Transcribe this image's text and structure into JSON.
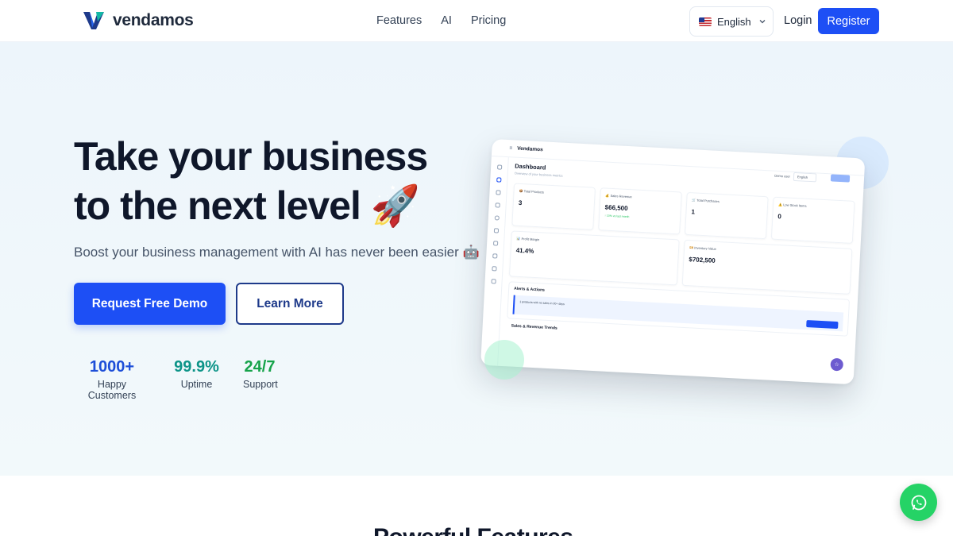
{
  "header": {
    "brand": "vendamos",
    "nav": [
      "Features",
      "AI",
      "Pricing"
    ],
    "language": "English",
    "login": "Login",
    "register": "Register"
  },
  "hero": {
    "title_line1": "Take your business",
    "title_line2": "to the next level 🚀",
    "subtitle": "Boost your business management with AI has never been easier 🤖",
    "cta_primary": "Request Free Demo",
    "cta_secondary": "Learn More",
    "stats": [
      {
        "value": "1000+",
        "label": "Happy Customers",
        "color": "#1d4ed8"
      },
      {
        "value": "99.9%",
        "label": "Uptime",
        "color": "#0d9488"
      },
      {
        "value": "24/7",
        "label": "Support",
        "color": "#16a34a"
      }
    ]
  },
  "mockup": {
    "app_name": "Vendamos",
    "title": "Dashboard",
    "subtitle": "Overview of your business metrics",
    "lang_label": "Demo user",
    "lang_value": "English",
    "cards": [
      {
        "label": "Total Products",
        "value": "3",
        "icon": "📦"
      },
      {
        "label": "Sales Revenue",
        "value": "$66,500",
        "icon": "💰",
        "note": "↑ 10% vs last month"
      },
      {
        "label": "Total Purchases",
        "value": "1",
        "icon": "🛒"
      },
      {
        "label": "Low Stock Items",
        "value": "0",
        "icon": "⚠️"
      }
    ],
    "cards2": [
      {
        "label": "Profit Margin",
        "value": "41.4%",
        "icon": "📊"
      },
      {
        "label": "Inventory Value",
        "value": "$702,500",
        "icon": "💴"
      }
    ],
    "alerts_title": "Alerts & Actions",
    "alert_text": "1 products with no sales in 30+ days",
    "trends_title": "Sales & Revenue Trends"
  },
  "section": {
    "title": "Powerful Features"
  },
  "colors": {
    "primary": "#1d4ff5",
    "whatsapp": "#25d366"
  }
}
